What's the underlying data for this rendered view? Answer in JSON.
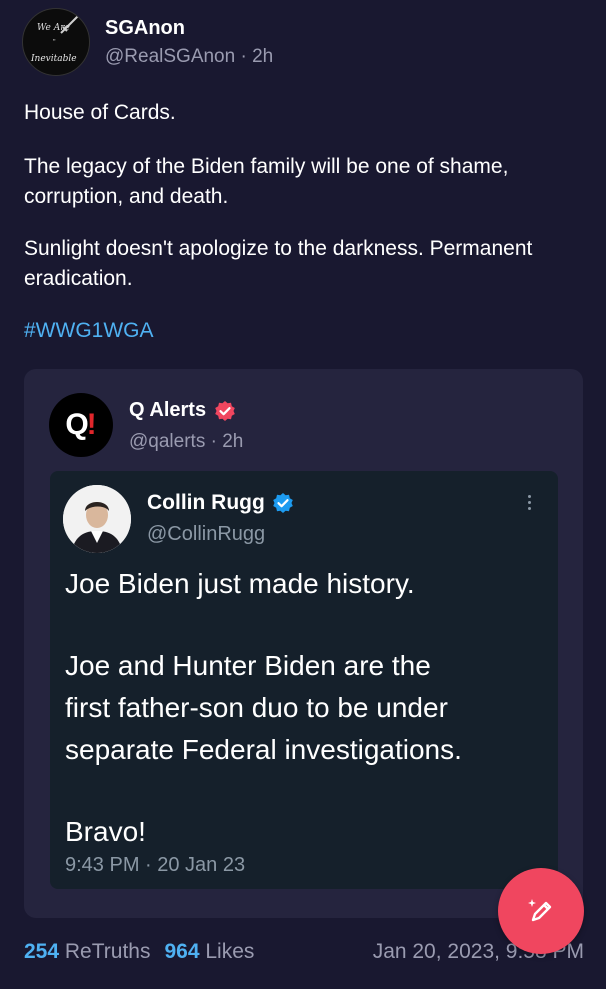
{
  "post": {
    "author_name": "SGAnon",
    "author_handle": "@RealSGAnon",
    "time": "· 2h",
    "avatar_text": [
      "We Are",
      "\"",
      "Inevitable"
    ],
    "paragraphs": [
      "House of Cards.",
      "The legacy of the Biden family will be one of shame, corruption, and death.",
      "Sunlight doesn't apologize to the darkness. Permanent eradication."
    ],
    "hashtag": "#WWG1WGA"
  },
  "quote": {
    "logo_q": "Q",
    "logo_bang": "!",
    "author_name": "Q Alerts",
    "author_handle": "@qalerts",
    "time": "· 2h",
    "badge_color": "#f0465f",
    "tweet": {
      "author_name": "Collin Rugg",
      "author_handle": "@CollinRugg",
      "verified_color": "#1d9bf0",
      "lines": [
        "Joe Biden just made history.",
        "Joe and Hunter Biden are the",
        "first father-son duo to be under",
        "separate Federal investigations.",
        "Bravo!"
      ],
      "timestamp": "9:43 PM · 20 Jan 23"
    }
  },
  "footer": {
    "retruths_count": "254",
    "retruths_label": "ReTruths",
    "likes_count": "964",
    "likes_label": "Likes",
    "date": "Jan 20, 2023, 9:58 PM"
  },
  "compose_button": {
    "icon": "pencil-sparkle-icon",
    "color": "#f0465f"
  },
  "colors": {
    "background": "#191830",
    "card": "#25243e",
    "link": "#4fb1f2"
  }
}
